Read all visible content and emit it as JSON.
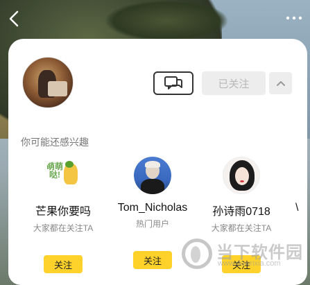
{
  "nav": {
    "back_icon": "chevron-left-icon",
    "more_icon": "ellipsis-icon"
  },
  "profile": {
    "message_icon": "chat-bubbles-icon",
    "follow_state_label": "已关注",
    "expand_icon": "chevron-up-icon"
  },
  "recommendations": {
    "title": "你可能还感兴趣",
    "items": [
      {
        "name": "芒果你要吗",
        "subtitle": "大家都在关注TA",
        "follow_label": "关注",
        "sticker_text": "萌萌哒!"
      },
      {
        "name": "Tom_Nicholas",
        "subtitle": "热门用户",
        "follow_label": "关注"
      },
      {
        "name": "孙诗雨0718",
        "subtitle": "大家都在关注TA",
        "follow_label": "关注"
      }
    ],
    "partial_name": "\\"
  },
  "watermark": {
    "brand": "当下软件园",
    "url": "www.downxia.com"
  },
  "colors": {
    "follow_button": "#fed22a",
    "disabled_button": "#ededed"
  }
}
